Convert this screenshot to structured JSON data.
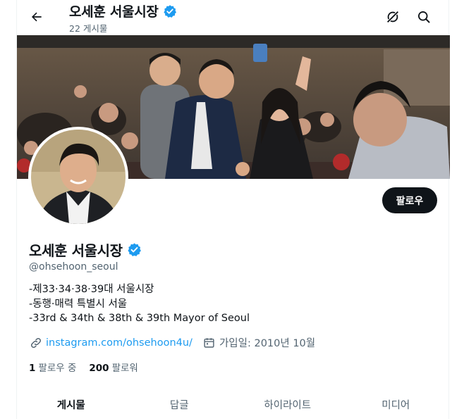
{
  "header": {
    "name": "오세훈 서울시장",
    "post_count": "22 게시물",
    "icons": [
      "back-arrow-icon",
      "verified-badge-icon",
      "grok-icon",
      "search-icon"
    ]
  },
  "profile": {
    "name": "오세훈 서울시장",
    "handle": "@ohsehoon_seoul",
    "follow_label": "팔로우",
    "bio": [
      "-제33·34·38·39대 서울시장",
      "-동행·매력 특별시 서울",
      "-33rd & 34th & 38th & 39th Mayor of Seoul"
    ],
    "link": "instagram.com/ohsehoon4u/",
    "joined": "가입일: 2010년 10월",
    "following_count": "1",
    "following_label": "팔로우 중",
    "followers_count": "200",
    "followers_label": "팔로워"
  },
  "tabs": [
    {
      "label": "게시물",
      "active": true
    },
    {
      "label": "답글",
      "active": false
    },
    {
      "label": "하이라이트",
      "active": false
    },
    {
      "label": "미디어",
      "active": false
    }
  ],
  "colors": {
    "verified": "#1d9bf0",
    "link": "#1d9bf0",
    "follow_button": "#0f1419",
    "muted_text": "#536471"
  }
}
